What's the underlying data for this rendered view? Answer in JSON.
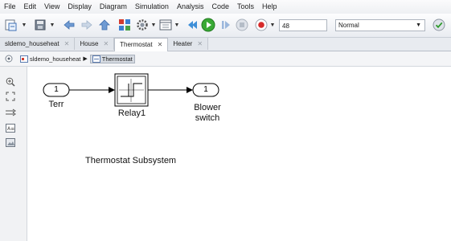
{
  "menu": [
    "File",
    "Edit",
    "View",
    "Display",
    "Diagram",
    "Simulation",
    "Analysis",
    "Code",
    "Tools",
    "Help"
  ],
  "toolbar": {
    "stop_time": "48",
    "sim_mode": "Normal"
  },
  "tabs": [
    {
      "label": "sldemo_househeat",
      "active": false
    },
    {
      "label": "House",
      "active": false
    },
    {
      "label": "Thermostat",
      "active": true
    },
    {
      "label": "Heater",
      "active": false
    }
  ],
  "breadcrumb": {
    "root": "sldemo_househeat",
    "separator": "▶",
    "current": "Thermostat"
  },
  "diagram": {
    "inport": {
      "number": "1",
      "label": "Terr"
    },
    "relay": {
      "label": "Relay1"
    },
    "outport": {
      "number": "1",
      "label_line1": "Blower",
      "label_line2": "switch"
    },
    "annotation": "Thermostat Subsystem"
  }
}
